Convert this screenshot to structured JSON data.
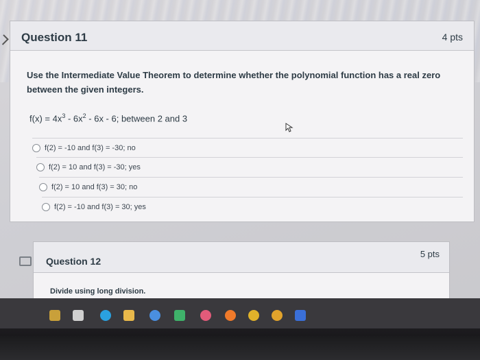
{
  "question11": {
    "title": "Question 11",
    "points": "4 pts",
    "prompt": "Use the Intermediate Value Theorem to determine whether the polynomial function has a real zero between the given integers.",
    "function_parts": {
      "lead": "f(x) = 4x",
      "exp1": "3",
      "mid": " - 6x",
      "exp2": "2",
      "tail": " - 6x - 6; between 2 and 3"
    },
    "answers": [
      {
        "label": "f(2) = -10 and f(3) = -30; no"
      },
      {
        "label": "f(2) = 10 and f(3) = -30; yes"
      },
      {
        "label": "f(2) = 10 and f(3) = 30; no"
      },
      {
        "label": "f(2) = -10 and f(3) = 30; yes"
      }
    ]
  },
  "question12": {
    "title": "Question 12",
    "points": "5 pts",
    "prompt": "Divide using long division."
  },
  "taskbar": {
    "icons": [
      {
        "name": "download-icon",
        "color": "#c9a03a"
      },
      {
        "name": "task-view-icon",
        "color": "#d0d0d0"
      },
      {
        "name": "edge-browser-icon",
        "color": "#2aa1e0"
      },
      {
        "name": "store-icon",
        "color": "#e8b84a"
      },
      {
        "name": "app-icon",
        "color": "#4a8fe0"
      },
      {
        "name": "files-icon",
        "color": "#3fb26a"
      },
      {
        "name": "music-icon",
        "color": "#e25b7a"
      },
      {
        "name": "firefox-icon",
        "color": "#f07a2a"
      },
      {
        "name": "chrome-icon",
        "color": "#e0b22a"
      },
      {
        "name": "check-app-icon",
        "color": "#e2a32b"
      },
      {
        "name": "video-icon",
        "color": "#3a6fd8"
      }
    ]
  }
}
